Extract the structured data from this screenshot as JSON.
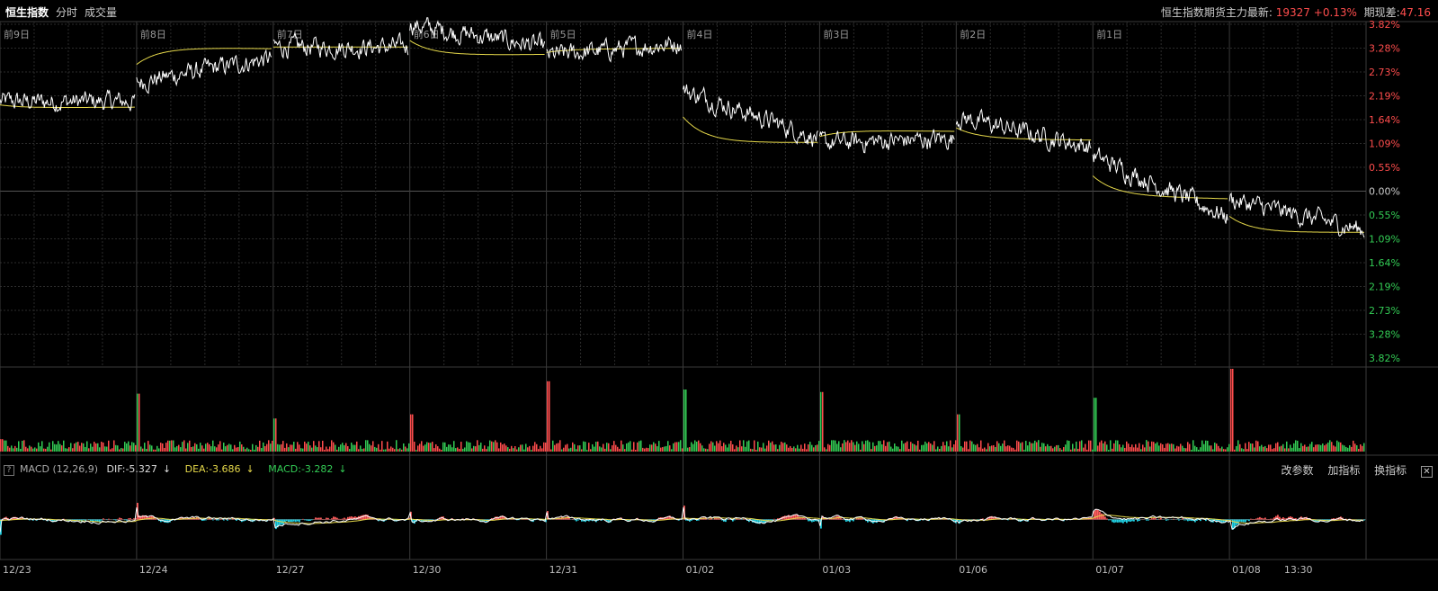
{
  "tabs": [
    {
      "label": "恒生指数",
      "active": true
    },
    {
      "label": "分时",
      "active": false
    },
    {
      "label": "成交量",
      "active": false
    }
  ],
  "quote": {
    "label": "恒生指数期货主力最新:",
    "price": "19327",
    "change": "+0.13%",
    "basis_label": "期现差:",
    "basis": "47.16"
  },
  "day_labels": [
    "前9日",
    "前8日",
    "前7日",
    "前6日",
    "前5日",
    "前4日",
    "前3日",
    "前2日",
    "前1日"
  ],
  "date_labels": [
    "12/23",
    "12/24",
    "12/27",
    "12/30",
    "12/31",
    "01/02",
    "01/03",
    "01/06",
    "01/07",
    "01/08",
    "13:30"
  ],
  "pct_labels": [
    "3.82%",
    "3.28%",
    "2.73%",
    "2.19%",
    "1.64%",
    "1.09%",
    "0.55%",
    "0.00%",
    "0.55%",
    "1.09%",
    "1.64%",
    "2.19%",
    "2.73%",
    "3.28%",
    "3.82%"
  ],
  "macd": {
    "help": "?",
    "title": "MACD (12,26,9)",
    "dif": "DIF:-5.327",
    "dea": "DEA:-3.686",
    "macd": "MACD:-3.282",
    "arrow": "↓",
    "tools": [
      "改参数",
      "加指标",
      "换指标"
    ],
    "close": "✕"
  },
  "colors": {
    "up": "#ff4d4d",
    "down": "#33cc55",
    "price": "#ffffff",
    "avg": "#e5d84a",
    "grid": "#2b2b2b",
    "macd_up": "#ff5c5c",
    "macd_down": "#22d3e6",
    "dea": "#e5d84a"
  },
  "chart_data": {
    "type": "line",
    "ylim_pct": [
      -3.82,
      3.82
    ],
    "sessions": [
      {
        "label": "12/23",
        "open": 2.05,
        "close": 2.05,
        "avg": 1.9
      },
      {
        "label": "12/24",
        "open": 2.5,
        "close": 3.05,
        "avg": 3.3
      },
      {
        "label": "12/27",
        "open": 3.3,
        "close": 3.3,
        "avg": 3.3
      },
      {
        "label": "12/30",
        "open": 3.8,
        "close": 3.3,
        "avg": 3.1
      },
      {
        "label": "12/31",
        "open": 3.1,
        "close": 3.4,
        "avg": 3.25
      },
      {
        "label": "01/02",
        "open": 2.3,
        "close": 1.2,
        "avg": 1.1
      },
      {
        "label": "01/03",
        "open": 1.1,
        "close": 1.2,
        "avg": 1.4
      },
      {
        "label": "01/06",
        "open": 1.7,
        "close": 1.0,
        "avg": 1.2
      },
      {
        "label": "01/07",
        "open": 0.8,
        "close": -0.6,
        "avg": -0.1
      },
      {
        "label": "01/08",
        "open": -0.2,
        "close": -0.9,
        "avg": -0.95
      }
    ],
    "volume_spikes": [
      0.15,
      0.7,
      0.4,
      0.45,
      0.85,
      0.75,
      0.72,
      0.45,
      0.65,
      1.0
    ]
  }
}
